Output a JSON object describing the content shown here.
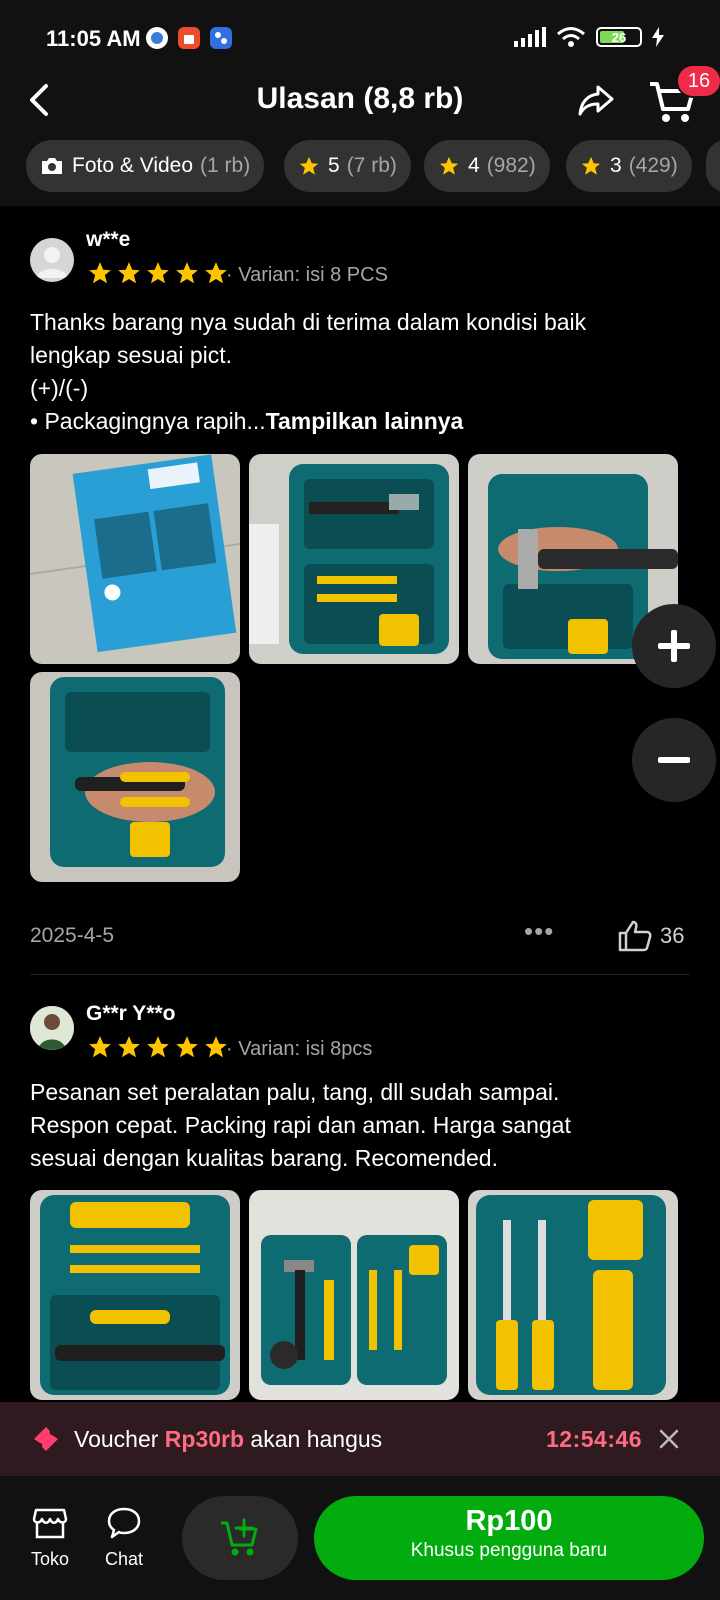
{
  "status_bar": {
    "time": "11:05 AM",
    "battery": "26"
  },
  "header": {
    "title": "Ulasan (8,8 rb)",
    "cart_count": "16"
  },
  "filters": [
    {
      "label": "Foto & Video",
      "count": "(1 rb)",
      "icon": "camera-icon"
    },
    {
      "label": "5",
      "count": "(7 rb)",
      "icon": "star-icon"
    },
    {
      "label": "4",
      "count": "(982)",
      "icon": "star-icon"
    },
    {
      "label": "3",
      "count": "(429)",
      "icon": "star-icon"
    }
  ],
  "reviews": [
    {
      "reviewer": "w**e",
      "rating": 5,
      "variant": "· Varian: isi 8 PCS",
      "text_lines": [
        "Thanks barang nya sudah di terima dalam kondisi baik",
        "lengkap sesuai pict.",
        "(+)/(-)",
        "• Packagingnya rapih..."
      ],
      "more_label": "Tampilkan lainnya",
      "photo_count": 4,
      "date": "2025-4-5",
      "likes": "36"
    },
    {
      "reviewer": "G**r Y**o",
      "rating": 5,
      "variant": "· Varian: isi 8pcs",
      "text_lines": [
        "Pesanan set peralatan palu, tang, dll sudah sampai.",
        "Respon cepat. Packing rapi dan aman. Harga sangat",
        "sesuai dengan kualitas barang. Recomended."
      ],
      "photo_count": 3
    }
  ],
  "voucher": {
    "prefix": "Voucher ",
    "amount": "Rp30rb",
    "suffix": " akan hangus",
    "timer": "12:54:46"
  },
  "bottom_nav": {
    "shop_label": "Toko",
    "chat_label": "Chat",
    "buy_price": "Rp100",
    "buy_subtitle": "Khusus pengguna baru"
  },
  "colors": {
    "accent_green": "#03ac0e",
    "badge_red": "#ee2b48",
    "voucher_pink": "#ff6b80",
    "star_yellow": "#ffc400"
  }
}
